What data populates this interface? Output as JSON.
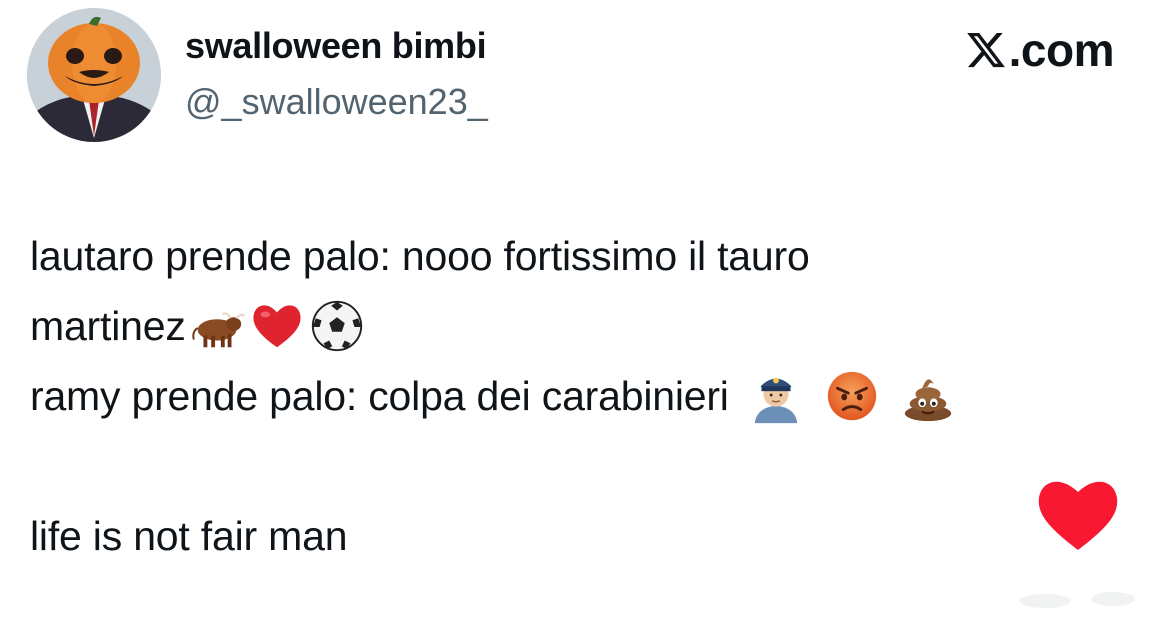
{
  "header": {
    "display_name": "swalloween bimbi",
    "handle": "@_swalloween23_",
    "brand_text": ".com",
    "brand_icon": "x-logo-icon",
    "avatar_icon": "pumpkin-head-avatar"
  },
  "tweet": {
    "lines": [
      "lautaro prende palo: nooo fortissimo il tauro",
      "martinez",
      "ramy prende palo: colpa dei carabinieri",
      "",
      "life is not fair man"
    ],
    "emojis_line2": [
      "ox-emoji",
      "red-heart-emoji",
      "soccer-ball-emoji"
    ],
    "emojis_line3": [
      "police-officer-emoji",
      "angry-face-emoji",
      "pile-of-poo-emoji"
    ]
  },
  "like": {
    "icon": "heart-icon",
    "color": "#f91831"
  },
  "colors": {
    "text": "#0f1419",
    "secondary": "#536471",
    "background": "#ffffff"
  }
}
